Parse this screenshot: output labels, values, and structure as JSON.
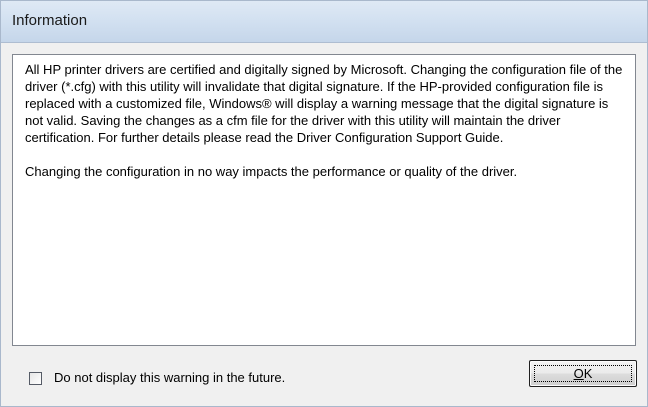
{
  "dialog": {
    "title": "Information",
    "message_paragraphs": [
      "All HP printer drivers are certified and digitally signed by Microsoft. Changing the configuration file of the driver (*.cfg) with this utility will invalidate that digital signature. If the HP-provided configuration file is replaced with a customized file, Windows® will display a warning message that the digital signature is not valid. Saving the changes as a cfm file for the driver with this utility will maintain the driver certification. For further details please read the Driver Configuration Support Guide.",
      "Changing the configuration in no way impacts the performance or quality of the driver."
    ],
    "checkbox": {
      "label": "Do not display this warning in the future.",
      "checked": false
    },
    "ok_button": {
      "mnemonic": "O",
      "rest": "K"
    }
  }
}
